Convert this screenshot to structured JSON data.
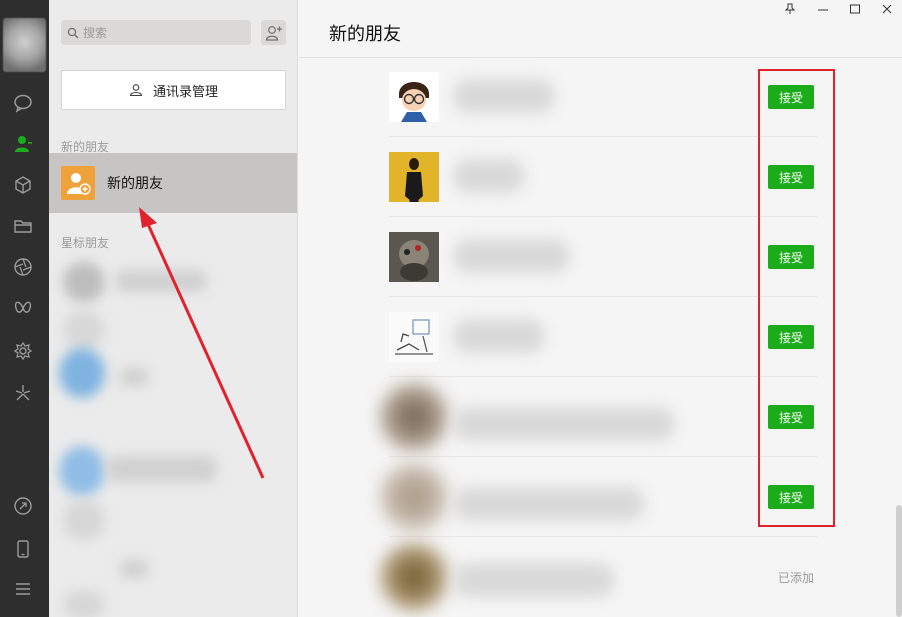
{
  "sidebar_icons": [
    "chat-bubble-icon",
    "contacts-icon",
    "cube-icon",
    "folder-icon",
    "aperture-icon",
    "butterfly-icon",
    "gear-flower-icon",
    "sparkle-icon",
    "link-icon",
    "phone-icon",
    "menu-icon"
  ],
  "search": {
    "placeholder": "搜索"
  },
  "contacts": {
    "manage_button": "通讯录管理",
    "section_new_friends": "新的朋友",
    "new_friends_item": "新的朋友",
    "section_starred": "星标朋友"
  },
  "main": {
    "title": "新的朋友",
    "friends": [
      {
        "status": "accept",
        "accept_label": "接受"
      },
      {
        "status": "accept",
        "accept_label": "接受"
      },
      {
        "status": "accept",
        "accept_label": "接受"
      },
      {
        "status": "accept",
        "accept_label": "接受"
      },
      {
        "status": "accept",
        "accept_label": "接受"
      },
      {
        "status": "accept",
        "accept_label": "接受"
      },
      {
        "status": "added",
        "added_label": "已添加"
      }
    ]
  },
  "colors": {
    "rail_bg": "#2e2e2e",
    "contacts_bg": "#ebebeb",
    "selected_row": "#c6c5c4",
    "accept_green": "#1aad19",
    "highlight_red": "#e0222d",
    "new_friends_icon": "#f0a23a",
    "active_icon_green": "#1aad19"
  }
}
